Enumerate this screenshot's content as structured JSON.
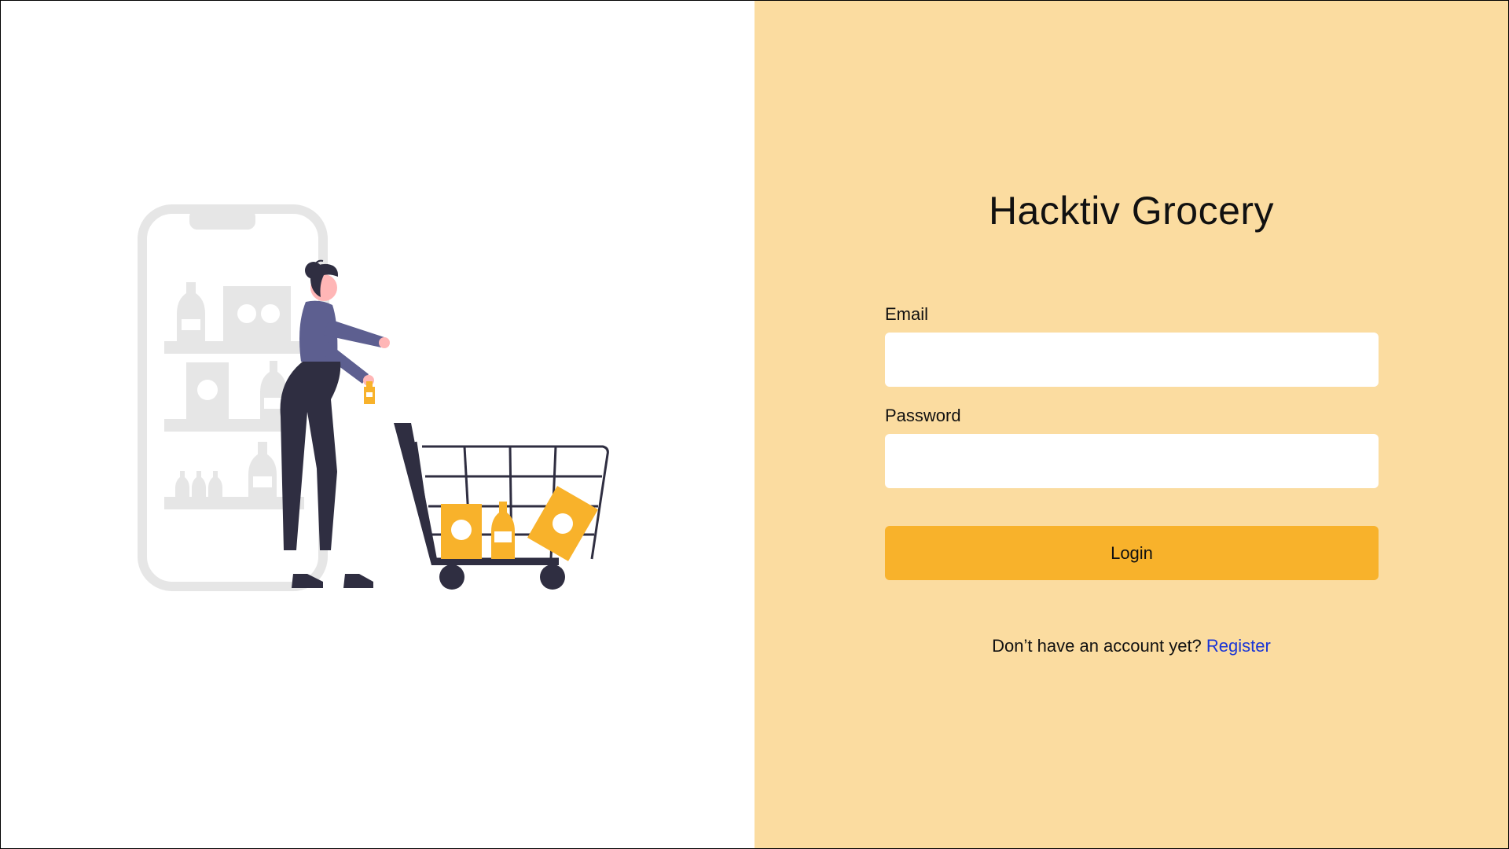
{
  "app": {
    "title": "Hacktiv Grocery"
  },
  "form": {
    "email_label": "Email",
    "email_value": "",
    "email_placeholder": "",
    "password_label": "Password",
    "password_value": "",
    "password_placeholder": "",
    "login_label": "Login"
  },
  "footer": {
    "prompt": "Don’t have an account yet?",
    "register_label": "Register"
  },
  "illustration": {
    "icons": [
      "phone-shelf-icon",
      "shopper-with-cart-icon"
    ]
  },
  "colors": {
    "panel_background": "#fbdca0",
    "button_background": "#f8b22b",
    "link": "#1a35d6",
    "illustration_accent": "#f8b22b",
    "illustration_dark": "#2f2e41",
    "illustration_shirt": "#5d5f90",
    "illustration_grey": "#e6e6e6"
  }
}
